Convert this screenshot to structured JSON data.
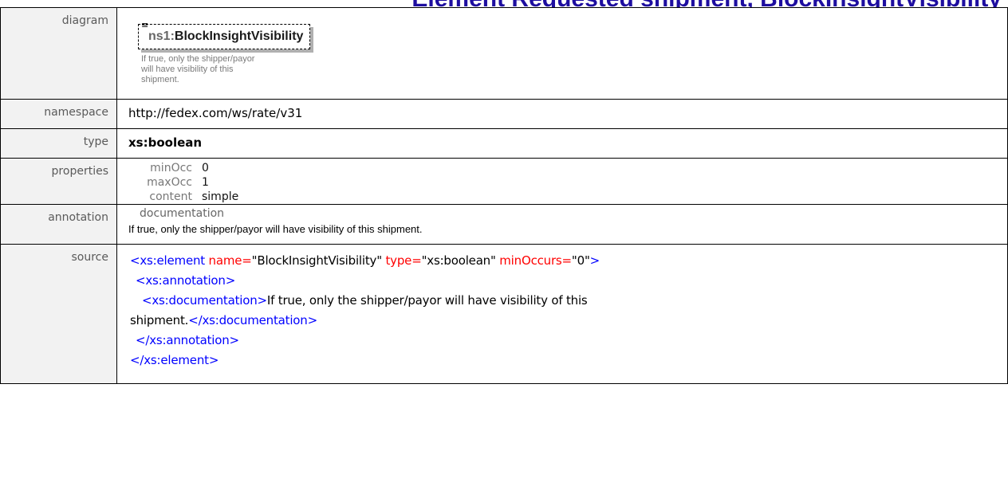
{
  "heading": {
    "visible_fragment": "Element Requested shipment, BlockInsightVisibility"
  },
  "diagram": {
    "label": "diagram",
    "node_prefix": "ns1:",
    "node_name": "BlockInsightVisibility",
    "node_note": "If true, only the shipper/payor will have visibility of this shipment."
  },
  "namespace": {
    "label": "namespace",
    "value": "http://fedex.com/ws/rate/v31"
  },
  "type": {
    "label": "type",
    "value": "xs:boolean"
  },
  "properties": {
    "label": "properties",
    "rows": [
      {
        "key": "minOcc",
        "value": "0"
      },
      {
        "key": "maxOcc",
        "value": "1"
      },
      {
        "key": "content",
        "value": "simple"
      }
    ]
  },
  "annotation": {
    "label": "annotation",
    "heading": "documentation",
    "text": "If true, only the shipper/payor will have visibility of this shipment."
  },
  "source": {
    "label": "source",
    "l1_open": "<xs:element",
    "l1_attr1": " name=",
    "l1_val1": "\"BlockInsightVisibility\"",
    "l1_attr2": " type=",
    "l1_val2": "\"xs:boolean\"",
    "l1_attr3": " minOccurs=",
    "l1_val3": "\"0\"",
    "l1_close": ">",
    "l2": "<xs:annotation>",
    "l3_open": "<xs:documentation>",
    "l3_text": "If true, only the shipper/payor will have visibility of this",
    "l4_text": "shipment.",
    "l4_close": "</xs:documentation>",
    "l5": "</xs:annotation>",
    "l6": "</xs:element>"
  }
}
